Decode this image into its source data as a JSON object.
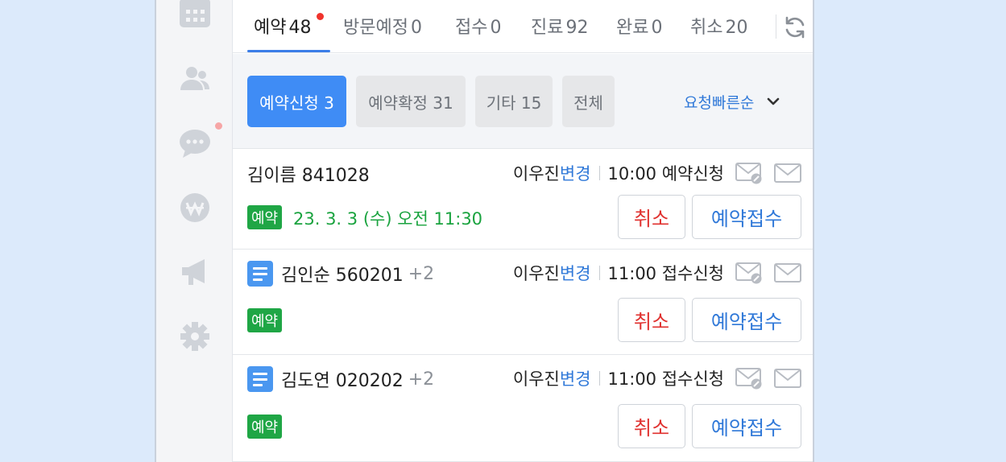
{
  "tabs": [
    {
      "label": "예약",
      "count": "48"
    },
    {
      "label": "방문예정",
      "count": "0"
    },
    {
      "label": "접수",
      "count": "0"
    },
    {
      "label": "진료",
      "count": "92"
    },
    {
      "label": "완료",
      "count": "0"
    },
    {
      "label": "취소",
      "count": "20"
    }
  ],
  "filters": [
    {
      "label": "예약신청 3"
    },
    {
      "label": "예약확정 31"
    },
    {
      "label": "기타 15"
    },
    {
      "label": "전체"
    }
  ],
  "sort_label": "요청빠른순",
  "rows": [
    {
      "name": "김이름 841028",
      "plus": "",
      "doctor": "이우진",
      "change": "변경",
      "time_status": "10:00 예약신청",
      "badge": "예약",
      "date": "23. 3. 3 (수) 오전 11:30",
      "cancel": "취소",
      "accept": "예약접수"
    },
    {
      "name": "김인순 560201",
      "plus": "+2",
      "doctor": "이우진",
      "change": "변경",
      "time_status": "11:00 접수신청",
      "badge": "예약",
      "date": "",
      "cancel": "취소",
      "accept": "예약접수"
    },
    {
      "name": "김도연 020202",
      "plus": "+2",
      "doctor": "이우진",
      "change": "변경",
      "time_status": "11:00 접수신청",
      "badge": "예약",
      "date": "",
      "cancel": "취소",
      "accept": "예약접수"
    }
  ],
  "colors": {
    "accent": "#3f8cf5",
    "link": "#2f78d8",
    "cancel": "#e0302e",
    "badge": "#1fa645",
    "dot": "#f0332c"
  },
  "icons": {
    "sidebar": [
      "calendar-icon",
      "users-icon",
      "chat-icon",
      "won-icon",
      "megaphone-icon",
      "gear-icon"
    ],
    "refresh": "refresh-icon",
    "mail": [
      "mail-check-icon",
      "mail-icon"
    ]
  }
}
